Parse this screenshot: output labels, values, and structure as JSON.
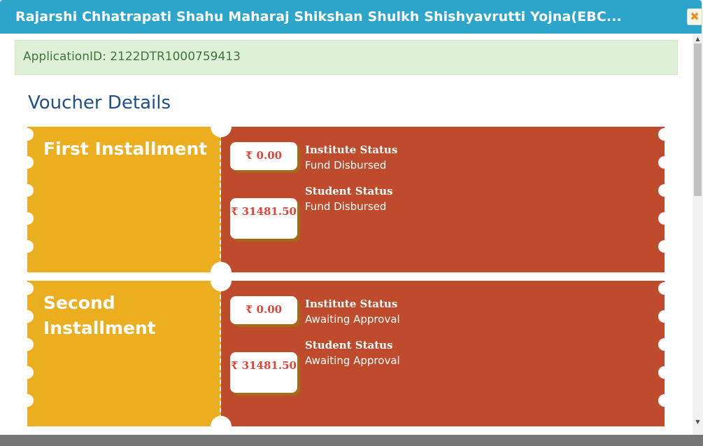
{
  "modal": {
    "title": "Rajarshi Chhatrapati Shahu Maharaj Shikshan Shulkh Shishyavrutti Yojna(EBC...",
    "close_icon": "close-icon"
  },
  "application_id": "ApplicationID: 2122DTR1000759413",
  "section_title": "Voucher Details",
  "installments": [
    {
      "title": "First Installment",
      "institute_amount": "₹ 0.00",
      "student_amount": "₹ 31481.50",
      "institute_label": "Institute Status",
      "institute_status": "Fund Disbursed",
      "student_label": "Student Status",
      "student_status": "Fund Disbursed"
    },
    {
      "title": "Second Installment",
      "institute_amount": "₹ 0.00",
      "student_amount": "₹ 31481.50",
      "institute_label": "Institute Status",
      "institute_status": "Awaiting Approval",
      "student_label": "Student Status",
      "student_status": "Awaiting Approval"
    }
  ],
  "colors": {
    "header": "#2da4c9",
    "voucher_left": "#ebae1e",
    "voucher_right": "#bd4b2c",
    "amount_text": "#e24437",
    "alert_bg": "#dff0d8",
    "title_blue": "#1f4f8a"
  }
}
